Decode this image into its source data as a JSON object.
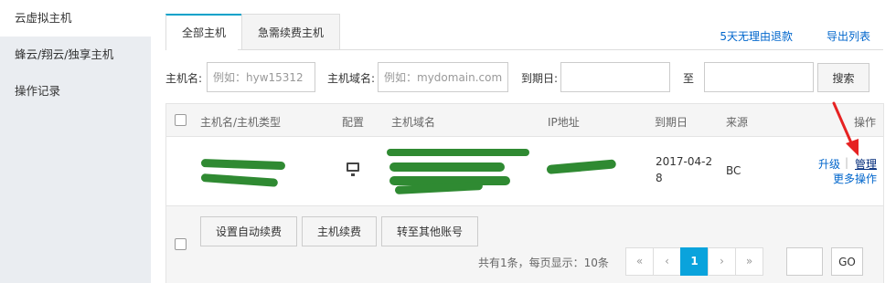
{
  "sidebar": {
    "items": [
      {
        "label": "云虚拟主机"
      },
      {
        "label": "蜂云/翔云/独享主机"
      },
      {
        "label": "操作记录"
      }
    ]
  },
  "tabs": [
    {
      "label": "全部主机"
    },
    {
      "label": "急需续费主机"
    }
  ],
  "top_links": {
    "refund": "5天无理由退款",
    "export": "导出列表"
  },
  "search": {
    "hostname_label": "主机名:",
    "hostname_placeholder": "例如：hyw15312",
    "domain_label": "主机域名:",
    "domain_placeholder": "例如：mydomain.com",
    "expire_label": "到期日:",
    "to_label": "至",
    "search_button": "搜索"
  },
  "table": {
    "headers": {
      "name": "主机名/主机类型",
      "config": "配置",
      "domain": "主机域名",
      "ip": "IP地址",
      "expire": "到期日",
      "source": "来源",
      "action": "操作"
    },
    "rows": [
      {
        "expire_line1": "2017-04-2",
        "expire_line2": "8",
        "source": "BC",
        "upgrade": "升级",
        "separator": "|",
        "manage": "管理",
        "more": "更多操作"
      }
    ]
  },
  "footer": {
    "auto_renew": "设置自动续费",
    "renew": "主机续费",
    "transfer": "转至其他账号",
    "page_info": "共有1条，每页显示：10条",
    "pager": [
      "«",
      "‹",
      "1",
      "›",
      "»"
    ],
    "go": "GO"
  },
  "colors": {
    "accent": "#0aa3dc",
    "link": "#0066cc",
    "redaction": "#2f8a32",
    "arrow": "#e62222"
  }
}
